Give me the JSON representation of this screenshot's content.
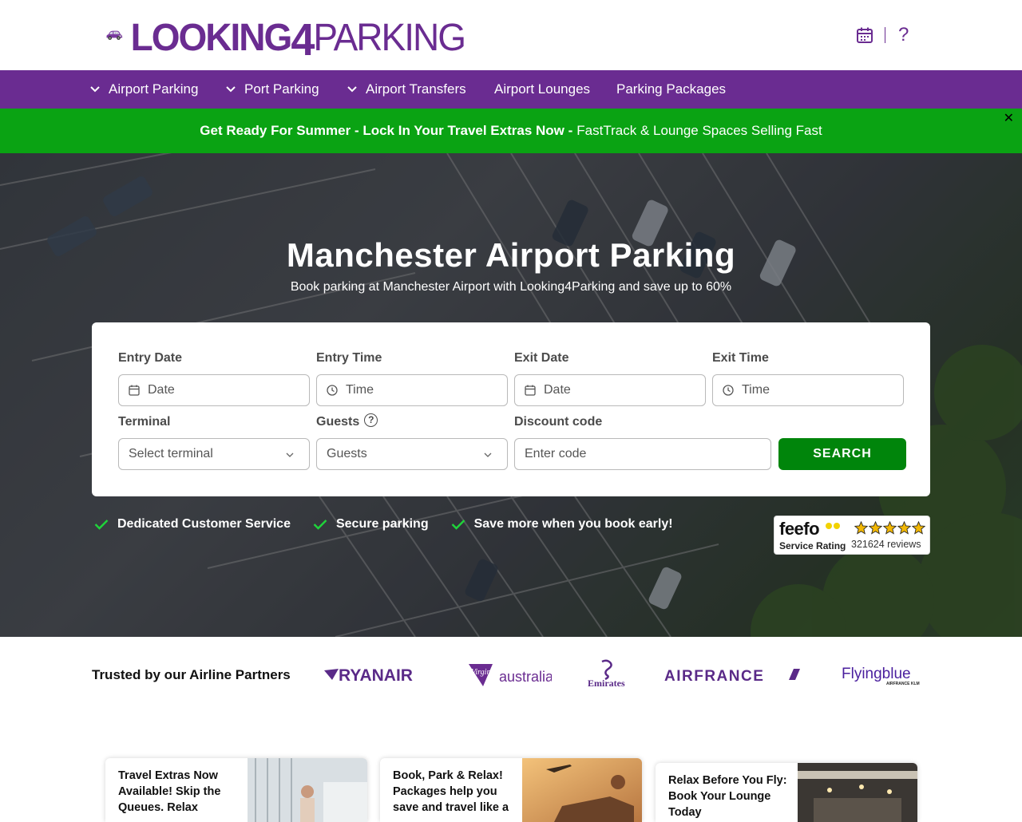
{
  "header": {
    "logo_text_1": "LOOKING",
    "logo_text_2": "4",
    "logo_text_3": "PARKING",
    "help_glyph": "?"
  },
  "nav": {
    "items": [
      {
        "label": "Airport Parking",
        "has_dropdown": true
      },
      {
        "label": "Port Parking",
        "has_dropdown": true
      },
      {
        "label": "Airport Transfers",
        "has_dropdown": true
      },
      {
        "label": "Airport Lounges",
        "has_dropdown": false
      },
      {
        "label": "Parking Packages",
        "has_dropdown": false
      }
    ]
  },
  "promo": {
    "bold": "Get Ready For Summer - Lock In Your Travel Extras Now -",
    "normal": "FastTrack & Lounge Spaces Selling Fast",
    "close": "✕"
  },
  "hero": {
    "title": "Manchester Airport Parking",
    "subtitle": "Book parking at Manchester Airport with Looking4Parking and save up to 60%"
  },
  "form": {
    "entry_date": {
      "label": "Entry Date",
      "placeholder": "Date"
    },
    "entry_time": {
      "label": "Entry Time",
      "placeholder": "Time"
    },
    "exit_date": {
      "label": "Exit Date",
      "placeholder": "Date"
    },
    "exit_time": {
      "label": "Exit Time",
      "placeholder": "Time"
    },
    "terminal": {
      "label": "Terminal",
      "value": "Select terminal"
    },
    "guests": {
      "label": "Guests",
      "value": "Guests"
    },
    "discount": {
      "label": "Discount code",
      "placeholder": "Enter code"
    },
    "search_label": "SEARCH"
  },
  "usps": [
    "Dedicated Customer Service",
    "Secure parking",
    "Save more when you book early!"
  ],
  "feefo": {
    "logo": "feefo",
    "label": "Service Rating",
    "reviews": "321624 reviews",
    "rating": 5
  },
  "partners": {
    "title": "Trusted by our Airline Partners",
    "logos": [
      {
        "name": "ryanair",
        "text": "RYANAIR"
      },
      {
        "name": "virgin-australia",
        "text_1": "Virgin",
        "text_2": "australia"
      },
      {
        "name": "emirates",
        "text": "Emirates"
      },
      {
        "name": "air-france",
        "text": "AIRFRANCE"
      },
      {
        "name": "flying-blue",
        "text": "Flyingblue",
        "sub": "AIRFRANCE KLM"
      }
    ]
  },
  "cards": [
    {
      "text": "Travel Extras Now Available! Skip the Queues. Relax"
    },
    {
      "text": "Book, Park & Relax! Packages help you save and travel like a"
    },
    {
      "text": "Relax Before You Fly: Book Your Lounge Today"
    }
  ],
  "colors": {
    "brand_purple": "#6a2c91",
    "promo_green": "#0aa313",
    "search_green": "#00850b",
    "feefo_star": "#f2b705"
  }
}
